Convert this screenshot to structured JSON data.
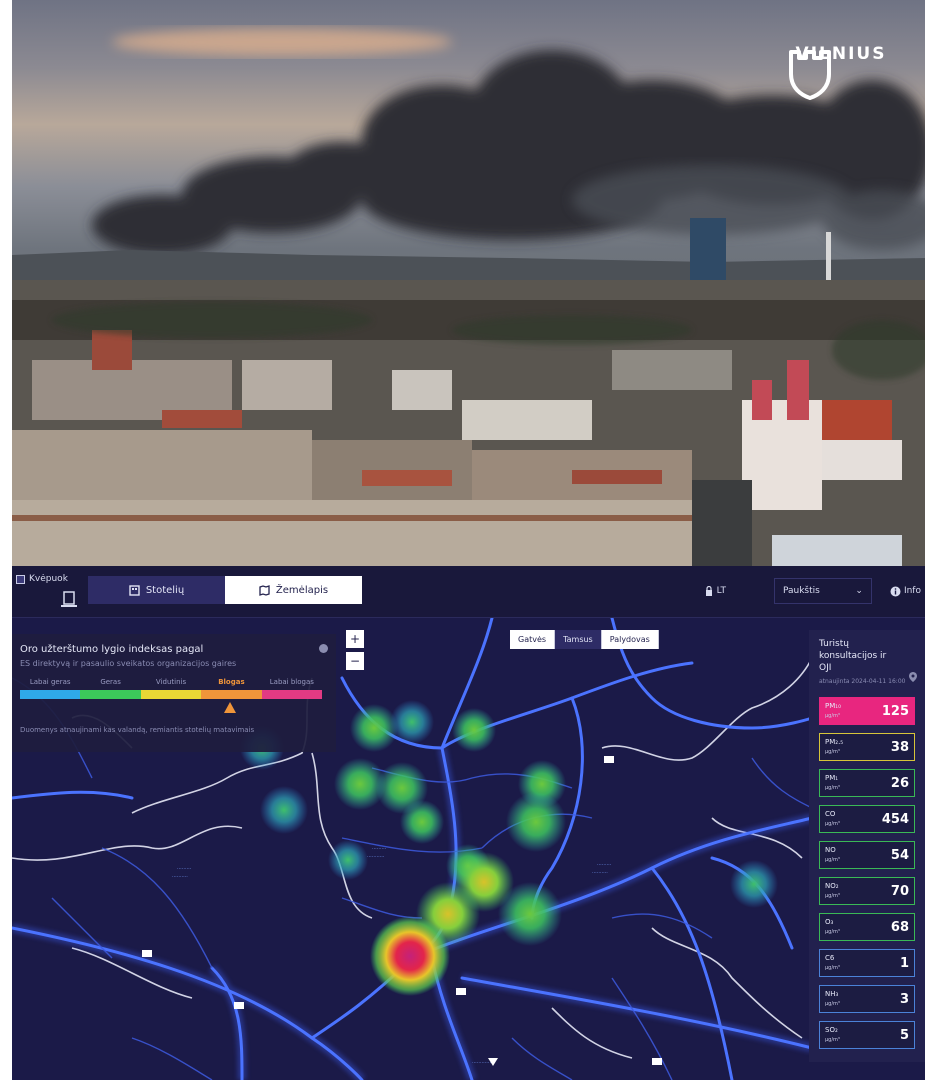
{
  "brand": {
    "wordmark": "VILNIUS"
  },
  "header": {
    "checkbox_label": "Kvėpuok",
    "tabs": [
      {
        "label": "Stotelių",
        "icon": "building-icon",
        "active": false
      },
      {
        "label": "Žemėlapis",
        "icon": "map-icon",
        "active": true
      }
    ],
    "language": "LT",
    "profile_label": "Paukštis",
    "info_label": "Info"
  },
  "legend": {
    "title": "Oro užterštumo lygio indeksas pagal",
    "subtitle": "ES direktyvą ir pasaulio sveikatos organizacijos gaires",
    "scale": [
      {
        "label": "Labai geras",
        "color": "#2fa9e8"
      },
      {
        "label": "Geras",
        "color": "#3cc85a"
      },
      {
        "label": "Vidutinis",
        "color": "#e9d735"
      },
      {
        "label": "Blogas",
        "color": "#f0953a"
      },
      {
        "label": "Labai blogas",
        "color": "#e23a83"
      }
    ],
    "current_index": 3,
    "note": "Duomenys atnaujinami kas valandą, remiantis stotelių matavimais"
  },
  "map": {
    "zoom_in": "+",
    "zoom_out": "−",
    "layers": [
      {
        "label": "Gatvės",
        "active": false
      },
      {
        "label": "Tamsus",
        "active": true
      },
      {
        "label": "Palydovas",
        "active": false
      }
    ]
  },
  "station": {
    "name": "Turistų konsultacijos ir OJI",
    "updated": "atnaujinta 2024-04-11 16:00",
    "pollutants": [
      {
        "name": "PM₁₀",
        "unit": "μg/m³",
        "value": "125",
        "level": "very-bad",
        "color": "#e8267f"
      },
      {
        "name": "PM₂.₅",
        "unit": "μg/m³",
        "value": "38",
        "level": "moderate",
        "color": "#d6c53a"
      },
      {
        "name": "PM₁",
        "unit": "μg/m³",
        "value": "26",
        "level": "good",
        "color": "#3ab956"
      },
      {
        "name": "CO",
        "unit": "μg/m³",
        "value": "454",
        "level": "good",
        "color": "#3ab956"
      },
      {
        "name": "NO",
        "unit": "μg/m³",
        "value": "54",
        "level": "good",
        "color": "#3ab956"
      },
      {
        "name": "NO₂",
        "unit": "μg/m³",
        "value": "70",
        "level": "good",
        "color": "#3ab956"
      },
      {
        "name": "O₃",
        "unit": "μg/m³",
        "value": "68",
        "level": "good",
        "color": "#3ab956"
      },
      {
        "name": "C6",
        "unit": "μg/m³",
        "value": "1",
        "level": "very-good",
        "color": "#4b82d8"
      },
      {
        "name": "NH₃",
        "unit": "μg/m³",
        "value": "3",
        "level": "very-good",
        "color": "#4b82d8"
      },
      {
        "name": "SO₂",
        "unit": "μg/m³",
        "value": "5",
        "level": "very-good",
        "color": "#4b82d8"
      }
    ]
  },
  "colors": {
    "app_bg": "#1b1a45",
    "road": "#3f63ff",
    "accent": "#f0953a"
  }
}
